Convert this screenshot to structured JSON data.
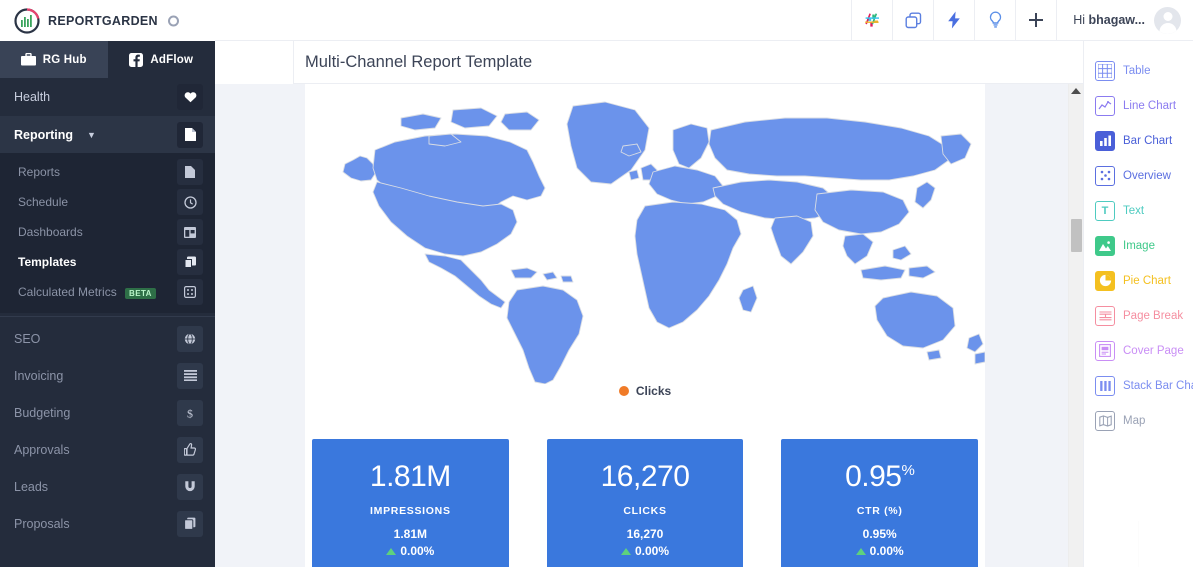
{
  "brand": {
    "name": "REPORTGARDEN",
    "logo_icon": "reportgarden-logo-icon",
    "collapse_icon": "collapse-circle-icon"
  },
  "tabs": [
    {
      "label": "RG Hub",
      "icon": "briefcase-icon",
      "active": true
    },
    {
      "label": "AdFlow",
      "icon": "facebook-icon",
      "active": false
    }
  ],
  "sidebar": {
    "items": [
      {
        "label": "Health",
        "icon": "heart-icon"
      },
      {
        "label": "Reporting",
        "icon": "document-icon",
        "expanded": true,
        "chevron": "chevron-down-icon"
      }
    ],
    "sub_items": [
      {
        "label": "Reports",
        "icon": "file-icon"
      },
      {
        "label": "Schedule",
        "icon": "clock-icon"
      },
      {
        "label": "Dashboards",
        "icon": "dashboard-icon"
      },
      {
        "label": "Templates",
        "icon": "layers-icon",
        "current": true
      },
      {
        "label": "Calculated Metrics",
        "badge": "BETA",
        "icon": "grid-dots-icon"
      }
    ],
    "lower_items": [
      {
        "label": "SEO",
        "icon": "globe-icon"
      },
      {
        "label": "Invoicing",
        "icon": "list-lines-icon"
      },
      {
        "label": "Budgeting",
        "icon": "dollar-icon"
      },
      {
        "label": "Approvals",
        "icon": "thumbs-up-icon"
      },
      {
        "label": "Leads",
        "icon": "magnet-icon"
      },
      {
        "label": "Proposals",
        "icon": "copy-pages-icon"
      }
    ]
  },
  "header": {
    "actions": [
      {
        "icon": "slack-icon"
      },
      {
        "icon": "clone-icon"
      },
      {
        "icon": "lightning-bolt-icon"
      },
      {
        "icon": "lightbulb-icon"
      },
      {
        "icon": "plus-icon"
      }
    ],
    "greeting_prefix": "Hi ",
    "user_name": "bhagaw...",
    "avatar_icon": "user-avatar-icon"
  },
  "title": "Multi-Channel Report Template",
  "report": {
    "map": {
      "legend_label": "Clicks",
      "legend_color": "#f07b28",
      "fill_color": "#6b93eb",
      "border_color": "#d9dde4"
    },
    "cards": [
      {
        "big": "1.81M",
        "sup": "",
        "label": "IMPRESSIONS",
        "sub": "1.81M",
        "delta": "0.00%",
        "trend": "up"
      },
      {
        "big": "16,270",
        "sup": "",
        "label": "CLICKS",
        "sub": "16,270",
        "delta": "0.00%",
        "trend": "up"
      },
      {
        "big": "0.95",
        "sup": "%",
        "label": "CTR (%)",
        "sub": "0.95%",
        "delta": "0.00%",
        "trend": "up"
      }
    ],
    "card_color": "#3a78dd"
  },
  "widgets": {
    "items": [
      {
        "label": "Table",
        "icon": "table-icon",
        "color": "#7b8df0"
      },
      {
        "label": "Line Chart",
        "icon": "line-chart-icon",
        "color": "#8b7bf0"
      },
      {
        "label": "Bar Chart",
        "icon": "bar-chart-icon",
        "color": "#4a5fd8"
      },
      {
        "label": "Overview",
        "icon": "overview-icon",
        "color": "#5b6fe0"
      },
      {
        "label": "Text",
        "icon": "text-icon",
        "color": "#4ecbc0"
      },
      {
        "label": "Image",
        "icon": "image-icon",
        "color": "#3fc98a"
      },
      {
        "label": "Pie Chart",
        "icon": "pie-chart-icon",
        "color": "#f4c020"
      },
      {
        "label": "Page Break",
        "icon": "page-break-icon",
        "color": "#f58ea0"
      },
      {
        "label": "Cover Page",
        "icon": "cover-page-icon",
        "color": "#c98ef5"
      },
      {
        "label": "Stack Bar Chart",
        "icon": "stack-bar-chart-icon",
        "color": "#7b8df0"
      },
      {
        "label": "Map",
        "icon": "map-icon",
        "color": "#9aa2b5"
      }
    ]
  },
  "scrollbar": {
    "up_arrow_icon": "scroll-up-arrow-icon",
    "thumb_icon": "scroll-thumb"
  }
}
